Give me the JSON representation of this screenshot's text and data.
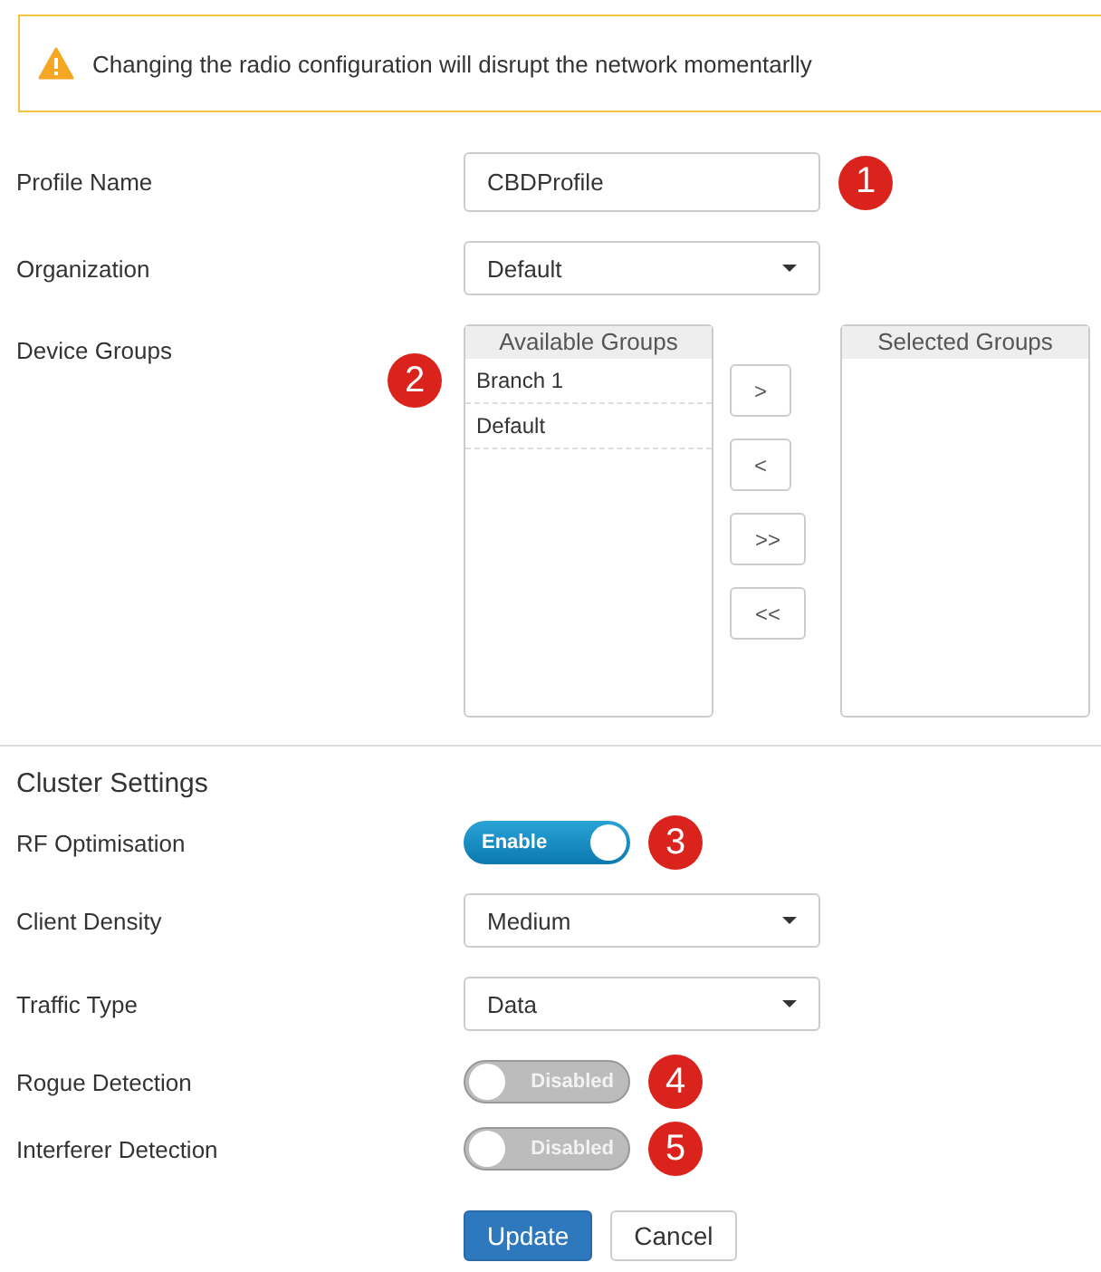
{
  "banner": {
    "text": "Changing the radio configuration will disrupt the network momentarlly"
  },
  "fields": [
    {
      "kind": "text",
      "label": "Profile Name",
      "value": "CBDProfile",
      "badge": "1"
    },
    {
      "kind": "select",
      "label": "Organization",
      "value": "Default"
    },
    {
      "kind": "groups",
      "label": "Device Groups",
      "badge": "2",
      "available": {
        "title": "Available Groups",
        "items": [
          "Branch 1",
          "Default"
        ]
      },
      "moves": [
        ">",
        "<",
        ">>",
        "<<"
      ],
      "selected": {
        "title": "Selected Groups"
      }
    }
  ],
  "section": {
    "title": "Cluster Settings"
  },
  "cluster_fields": [
    {
      "kind": "toggle",
      "label": "RF Optimisation",
      "on": true,
      "state_text": "Enable",
      "badge": "3"
    },
    {
      "kind": "select",
      "label": "Client Density",
      "value": "Medium"
    },
    {
      "kind": "select",
      "label": "Traffic Type",
      "value": "Data"
    },
    {
      "kind": "toggle",
      "label": "Rogue Detection",
      "on": false,
      "state_text": "Disabled",
      "badge": "4"
    },
    {
      "kind": "toggle",
      "label": "Interferer Detection",
      "on": false,
      "state_text": "Disabled",
      "badge": "5"
    }
  ],
  "buttons": [
    {
      "label": "Update",
      "primary": true
    },
    {
      "label": "Cancel",
      "primary": false
    }
  ]
}
